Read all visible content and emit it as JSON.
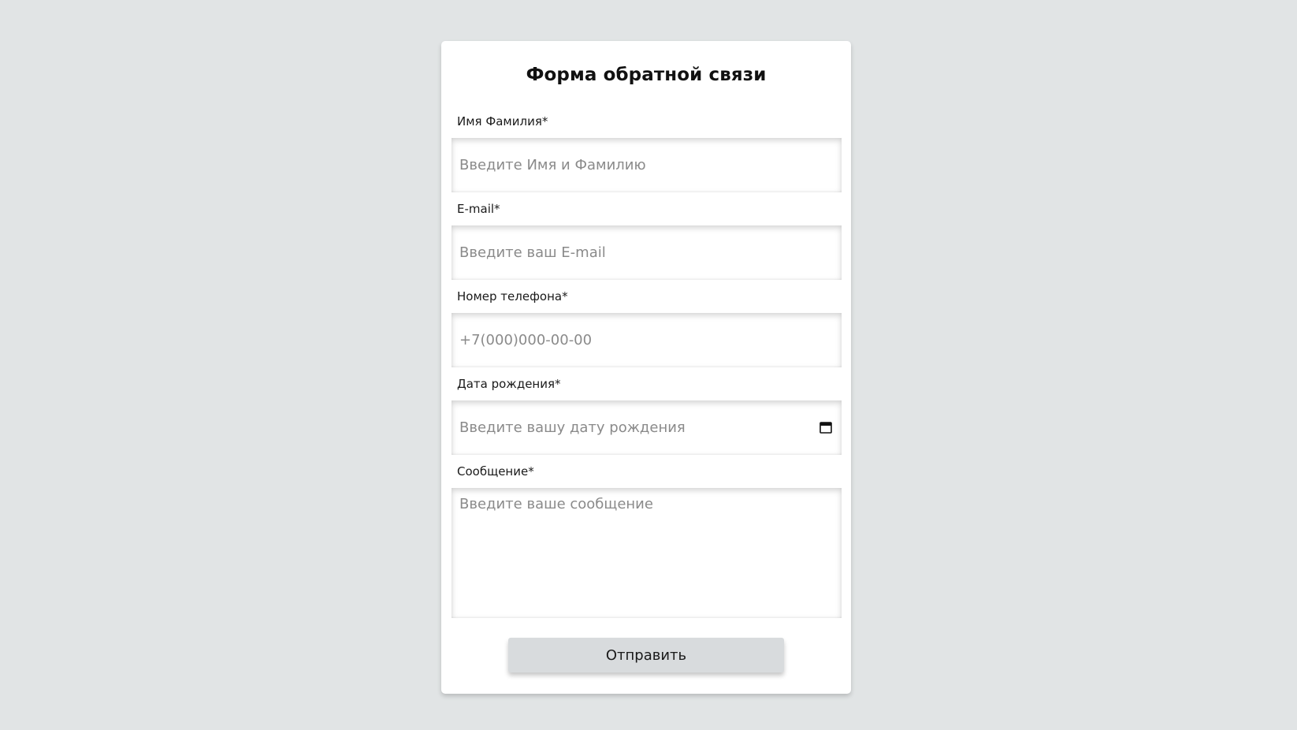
{
  "form": {
    "title": "Форма обратной связи",
    "fields": {
      "name": {
        "label": "Имя Фамилия*",
        "placeholder": "Введите Имя и Фамилию"
      },
      "email": {
        "label": "E-mail*",
        "placeholder": "Введите ваш E-mail"
      },
      "phone": {
        "label": "Номер телефона*",
        "placeholder": "+7(000)000-00-00"
      },
      "birthdate": {
        "label": "Дата рождения*",
        "placeholder": "Введите вашу дату рождения",
        "icon": "calendar-icon"
      },
      "message": {
        "label": "Сообщение*",
        "placeholder": "Введите ваше сообщение"
      }
    },
    "submit_label": "Отправить"
  },
  "colors": {
    "page_background": "#e1e4e5",
    "card_background": "#ffffff",
    "button_background": "#d8dbdd",
    "placeholder_text": "#8a8a8a"
  }
}
